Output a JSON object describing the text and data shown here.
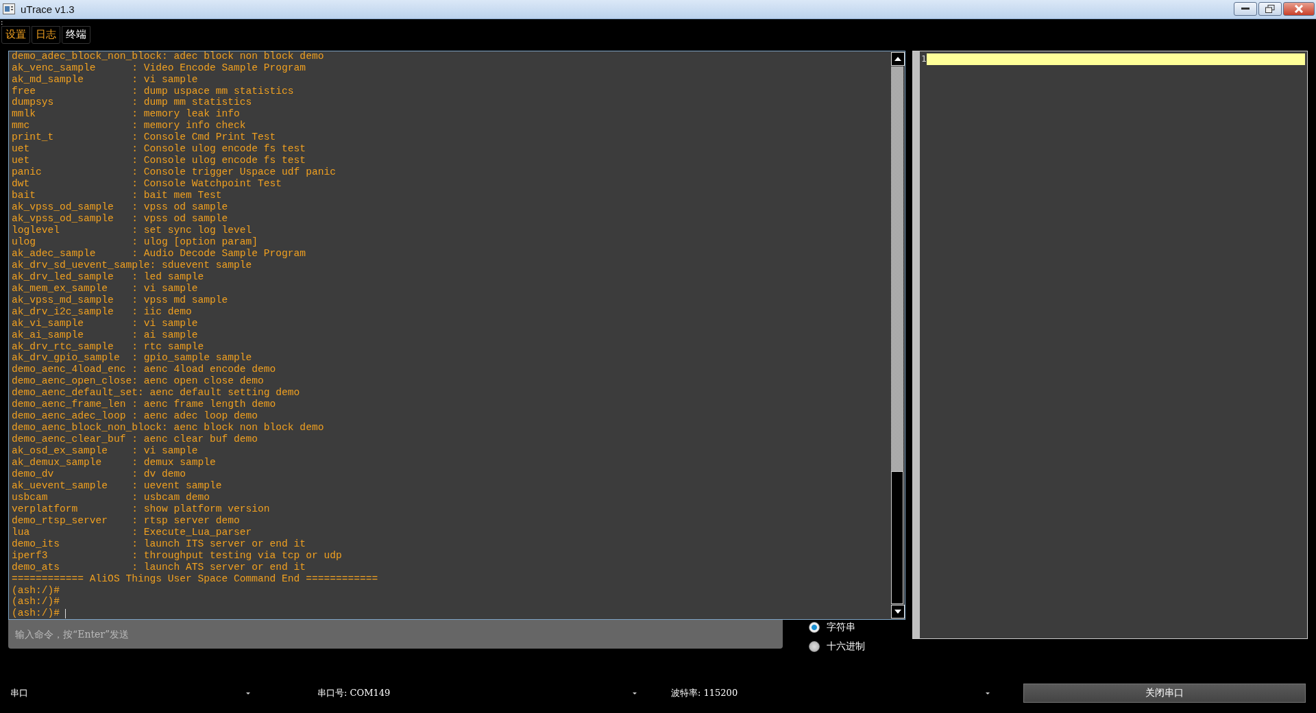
{
  "window": {
    "title": "uTrace v1.3"
  },
  "menu_mark": ":",
  "tabs": [
    {
      "label": "设置",
      "selected": false
    },
    {
      "label": "日志",
      "selected": false
    },
    {
      "label": "终端",
      "selected": true
    }
  ],
  "terminal": {
    "lines": [
      "demo_adec_block_non_block: adec block non block demo",
      "ak_venc_sample      : Video Encode Sample Program",
      "ak_md_sample        : vi sample",
      "free                : dump uspace mm statistics",
      "dumpsys             : dump mm statistics",
      "mmlk                : memory leak info",
      "mmc                 : memory info check",
      "print_t             : Console Cmd Print Test",
      "uet                 : Console ulog encode fs test",
      "uet                 : Console ulog encode fs test",
      "panic               : Console trigger Uspace udf panic",
      "dwt                 : Console Watchpoint Test",
      "bait                : bait mem Test",
      "ak_vpss_od_sample   : vpss od sample",
      "ak_vpss_od_sample   : vpss od sample",
      "loglevel            : set sync log level",
      "ulog                : ulog [option param]",
      "ak_adec_sample      : Audio Decode Sample Program",
      "ak_drv_sd_uevent_sample: sduevent sample",
      "ak_drv_led_sample   : led sample",
      "ak_mem_ex_sample    : vi sample",
      "ak_vpss_md_sample   : vpss md sample",
      "ak_drv_i2c_sample   : iic demo",
      "ak_vi_sample        : vi sample",
      "ak_ai_sample        : ai sample",
      "ak_drv_rtc_sample   : rtc sample",
      "ak_drv_gpio_sample  : gpio_sample sample",
      "demo_aenc_4load_enc : aenc 4load encode demo",
      "demo_aenc_open_close: aenc open close demo",
      "demo_aenc_default_set: aenc default setting demo",
      "demo_aenc_frame_len : aenc frame length demo",
      "demo_aenc_adec_loop : aenc adec loop demo",
      "demo_aenc_block_non_block: aenc block non block demo",
      "demo_aenc_clear_buf : aenc clear buf demo",
      "ak_osd_ex_sample    : vi sample",
      "ak_demux_sample     : demux sample",
      "demo_dv             : dv demo",
      "ak_uevent_sample    : uevent sample",
      "usbcam              : usbcam demo",
      "verplatform         : show platform version",
      "demo_rtsp_server    : rtsp server demo",
      "lua                 : Execute_Lua_parser",
      "demo_its            : launch ITS server or end it",
      "iperf3              : throughput testing via tcp or udp",
      "demo_ats            : launch ATS server or end it",
      "============ AliOS Things User Space Command End ============",
      "(ash:/)#",
      "(ash:/)#",
      "(ash:/)#"
    ]
  },
  "editor": {
    "line_number": "1"
  },
  "command_input": {
    "placeholder": "输入命令，按“Enter”发送"
  },
  "format_options": [
    {
      "label": "字符串",
      "selected": true
    },
    {
      "label": "十六进制",
      "selected": false
    }
  ],
  "bottom_bar": {
    "port_type": "串口",
    "port_label": "串口号:",
    "port_value": "COM149",
    "baud_label": "波特率:",
    "baud_value": "115200",
    "close_button": "关闭串口"
  }
}
